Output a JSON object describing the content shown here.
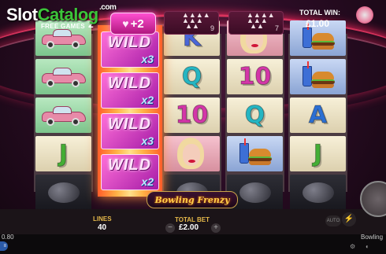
{
  "watermark": {
    "main": "Slot",
    "accent": "Catalog",
    "suffix": ".com"
  },
  "top_bar": {
    "free_games_label": "FREE GAMES",
    "free_games_count": "2",
    "free_games_added": "+2",
    "pin_counters": [
      "9",
      "7"
    ],
    "total_win_label": "TOTAL WIN:",
    "total_win_value": "£1.00"
  },
  "reels": [
    [
      "car",
      "car",
      "car",
      "J",
      "bowling-ball"
    ],
    [
      "wild",
      "wild",
      "wild",
      "wild",
      "wild"
    ],
    [
      "K",
      "Q",
      "10",
      "woman",
      "bowling-ball"
    ],
    [
      "woman",
      "10",
      "Q",
      "burger-meal",
      "bowling-ball"
    ],
    [
      "burger-meal",
      "burger-meal",
      "A",
      "J",
      "bowling-ball"
    ]
  ],
  "wild_symbols": [
    {
      "label": "WILD",
      "multiplier": "x3"
    },
    {
      "label": "WILD",
      "multiplier": "x2"
    },
    {
      "label": "WILD",
      "multiplier": "x3"
    },
    {
      "label": "WILD",
      "multiplier": "x2"
    }
  ],
  "logo_text": "Bowling Frenzy",
  "controls": {
    "lines_label": "LINES",
    "lines_value": "40",
    "total_bet_label": "TOTAL BET",
    "total_bet_value": "£2.00",
    "bet_minus": "−",
    "bet_plus": "+",
    "auto_label": "AUTO",
    "turbo_icon": "⚡"
  },
  "status": {
    "balance": "0.80",
    "game_name": "Bowling"
  },
  "colors": {
    "wild_pink": "#ff6fd8",
    "accent_gold": "#e5b84a",
    "frame": "#4b3b42"
  }
}
